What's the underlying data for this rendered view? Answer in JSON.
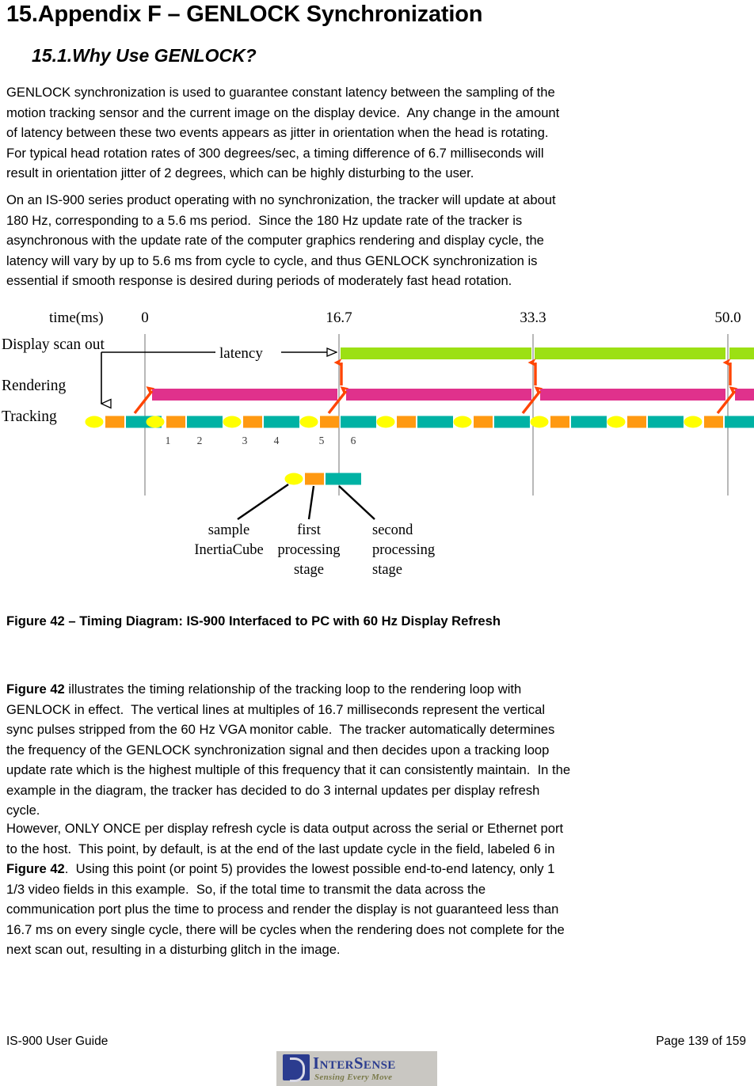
{
  "document": {
    "heading1": {
      "number": "15.",
      "text": "Appendix F – GENLOCK Synchronization"
    },
    "heading2": {
      "number": "15.1.",
      "text": "Why Use GENLOCK?"
    },
    "paragraph1": [
      "GENLOCK synchronization is used to guarantee constant latency between the sampling of the",
      "motion tracking sensor and the current image on the display device.  Any change in the amount",
      "of latency between these two events appears as jitter in orientation when the head is rotating.",
      "For typical head rotation rates of 300 degrees/sec, a timing difference of 6.7 milliseconds will",
      "result in orientation jitter of 2 degrees, which can be highly disturbing to the user."
    ],
    "paragraph2": [
      "On an IS-900 series product operating with no synchronization, the tracker will update at about",
      "180 Hz, corresponding to a 5.6 ms period.  Since the 180 Hz update rate of the tracker is",
      "asynchronous with the update rate of the computer graphics rendering and display cycle, the",
      "latency will vary by up to 5.6 ms from cycle to cycle, and thus GENLOCK synchronization is",
      "essential if smooth response is desired during periods of moderately fast head rotation."
    ],
    "figure_caption": "Figure 42 – Timing Diagram: IS-900 Interfaced to PC with 60 Hz Display Refresh",
    "paragraph4": [
      {
        "bold": "Figure 42",
        "rest": " illustrates the timing relationship of the tracking loop to the rendering loop with"
      },
      {
        "bold": "",
        "rest": "GENLOCK in effect.  The vertical lines at multiples of 16.7 milliseconds represent the vertical"
      },
      {
        "bold": "",
        "rest": "sync pulses stripped from the 60 Hz VGA monitor cable.  The tracker automatically determines"
      },
      {
        "bold": "",
        "rest": "the frequency of the GENLOCK synchronization signal and then decides upon a tracking loop"
      },
      {
        "bold": "",
        "rest": "update rate which is the highest multiple of this frequency that it can consistently maintain.  In the"
      },
      {
        "bold": "",
        "rest": "example in the diagram, the tracker has decided to do 3 internal updates per display refresh"
      },
      {
        "bold": "",
        "rest": "cycle."
      }
    ],
    "paragraph5": [
      {
        "bold": "",
        "rest": "However, ONLY ONCE per display refresh cycle is data output across the serial or Ethernet port"
      },
      {
        "bold": "",
        "rest": "to the host.  This point, by default, is at the end of the last update cycle in the field, labeled 6 in"
      },
      {
        "bold": "Figure 42",
        "rest": ".  Using this point (or point 5) provides the lowest possible end-to-end latency, only 1"
      },
      {
        "bold": "",
        "rest": "1/3 video fields in this example.  So, if the total time to transmit the data across the"
      },
      {
        "bold": "",
        "rest": "communication port plus the time to process and render the display is not guaranteed less than"
      },
      {
        "bold": "",
        "rest": "16.7 ms on every single cycle, there will be cycles when the rendering does not complete for the"
      },
      {
        "bold": "",
        "rest": "next scan out, resulting in a disturbing glitch in the image."
      }
    ]
  },
  "figure": {
    "axis_label": "time(ms)",
    "time_ticks": [
      "0",
      "16.7",
      "33.3",
      "50.0"
    ],
    "row_labels": [
      "Display scan out",
      "Rendering",
      "Tracking"
    ],
    "latency_label": "latency",
    "cell_numbers": [
      "1",
      "2",
      "3",
      "4",
      "5",
      "6"
    ],
    "callouts": [
      {
        "lines": [
          "sample",
          "InertiaCube"
        ]
      },
      {
        "lines": [
          "first",
          "processing",
          "stage"
        ]
      },
      {
        "lines": [
          "second",
          "processing",
          "stage"
        ]
      }
    ],
    "colors": {
      "display_scan_out": "#9CE013",
      "rendering": "#E0318C",
      "sample": "#FFFF00",
      "first_stage": "#FF9911",
      "second_stage": "#00B2A4",
      "sync_arrow": "#FF4400",
      "gridline": "#999999",
      "annotation": "#000000"
    }
  },
  "footer": {
    "left": "IS-900 User Guide",
    "right": "Page 139 of 159",
    "logo_word": "InterSense",
    "logo_tagline": "Sensing Every Move"
  }
}
